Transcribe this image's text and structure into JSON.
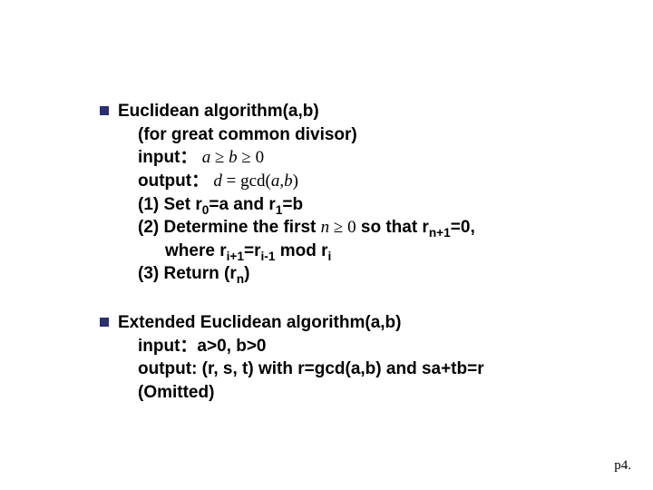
{
  "item1": {
    "title": "Euclidean algorithm(a,b)",
    "line1": "(for great common divisor)",
    "input_label": "input：",
    "input_math_a": "a",
    "input_math_ge1": "≥",
    "input_math_b": "b",
    "input_math_ge2": "≥",
    "input_math_zero": "0",
    "output_label": "output：",
    "output_math_d": "d",
    "output_math_eq": " = ",
    "output_math_gcd": "gcd(",
    "output_math_a": "a",
    "output_math_comma": ",",
    "output_math_b": "b",
    "output_math_close": ")",
    "step1_a": "(1) Set r",
    "step1_sub0": "0",
    "step1_b": "=a and r",
    "step1_sub1": "1",
    "step1_c": "=b",
    "step2_a": "(2) Determine the first ",
    "step2_math_n": "n",
    "step2_math_ge": " ≥ ",
    "step2_math_zero": "0",
    "step2_b": " so that r",
    "step2_sub_n1": "n+1",
    "step2_c": "=0,",
    "step2_where_a": "where  r",
    "step2_sub_ip1": "i+1",
    "step2_where_b": "=r",
    "step2_sub_im1": "i-1",
    "step2_where_c": " mod r",
    "step2_sub_i": "i",
    "step3_a": "(3) Return (r",
    "step3_sub_n": "n",
    "step3_b": ")"
  },
  "item2": {
    "title": "Extended Euclidean algorithm(a,b)",
    "input": "input：a>0, b>0",
    "output": "output: (r, s, t) with r=gcd(a,b) and sa+tb=r",
    "omitted": "(Omitted)"
  },
  "pagenum": "p4."
}
